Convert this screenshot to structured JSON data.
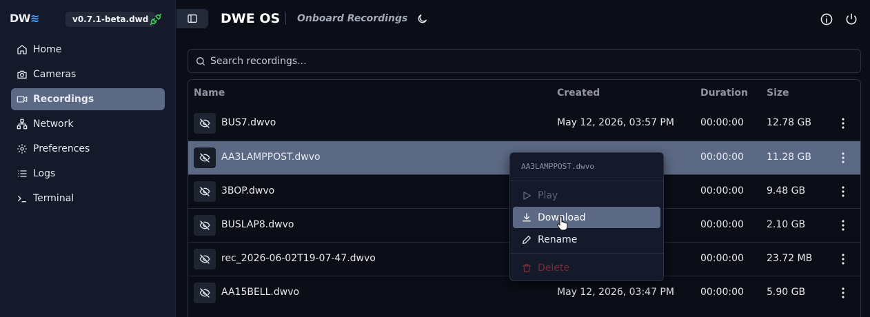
{
  "sidebar": {
    "logo_text": "DW",
    "logo_wave": "≋",
    "version": "v0.7.1-beta.dwd",
    "connection_icon": "plug-connected-icon",
    "items": [
      {
        "label": "Home",
        "icon": "home-icon",
        "active": false
      },
      {
        "label": "Cameras",
        "icon": "camera-icon",
        "active": false
      },
      {
        "label": "Recordings",
        "icon": "video-icon",
        "active": true
      },
      {
        "label": "Network",
        "icon": "network-icon",
        "active": false
      },
      {
        "label": "Preferences",
        "icon": "gear-icon",
        "active": false
      },
      {
        "label": "Logs",
        "icon": "list-icon",
        "active": false
      },
      {
        "label": "Terminal",
        "icon": "terminal-icon",
        "active": false
      }
    ]
  },
  "header": {
    "app_title": "DWE OS",
    "page_title": "Onboard Recordings",
    "theme_icon": "moon-icon",
    "info_icon": "info-icon",
    "power_icon": "power-icon"
  },
  "search": {
    "placeholder": "Search recordings...",
    "value": ""
  },
  "table": {
    "columns": [
      "Name",
      "Created",
      "Duration",
      "Size"
    ],
    "rows": [
      {
        "name": "BUS7.dwvo",
        "created": "May 12, 2026, 03:57 PM",
        "duration": "00:00:00",
        "size": "12.78 GB",
        "selected": false
      },
      {
        "name": "AA3LAMPPOST.dwvo",
        "created": "",
        "duration": "00:00:00",
        "size": "11.28 GB",
        "selected": true
      },
      {
        "name": "3BOP.dwvo",
        "created": "",
        "duration": "00:00:00",
        "size": "9.48 GB",
        "selected": false
      },
      {
        "name": "BUSLAP8.dwvo",
        "created": "",
        "duration": "00:00:00",
        "size": "2.10 GB",
        "selected": false
      },
      {
        "name": "rec_2026-06-02T19-07-47.dwvo",
        "created": "",
        "duration": "00:00:00",
        "size": "23.72 MB",
        "selected": false
      },
      {
        "name": "AA15BELL.dwvo",
        "created": "May 12, 2026, 03:47 PM",
        "duration": "00:00:00",
        "size": "5.90 GB",
        "selected": false
      }
    ]
  },
  "context_menu": {
    "title": "AA3LAMPPOST.dwvo",
    "items": [
      {
        "label": "Play",
        "icon": "play-icon",
        "state": "disabled"
      },
      {
        "label": "Download",
        "icon": "download-icon",
        "state": "hover"
      },
      {
        "label": "Rename",
        "icon": "pencil-icon",
        "state": "normal"
      },
      {
        "label": "Delete",
        "icon": "trash-icon",
        "state": "disabled-danger"
      }
    ]
  },
  "colors": {
    "background": "#0b0d17",
    "sidebar": "#141a2a",
    "accent": "#5c6984",
    "logo_wave": "#4ea3ff",
    "connected": "#3fcf5a",
    "danger": "#7b2a35"
  }
}
